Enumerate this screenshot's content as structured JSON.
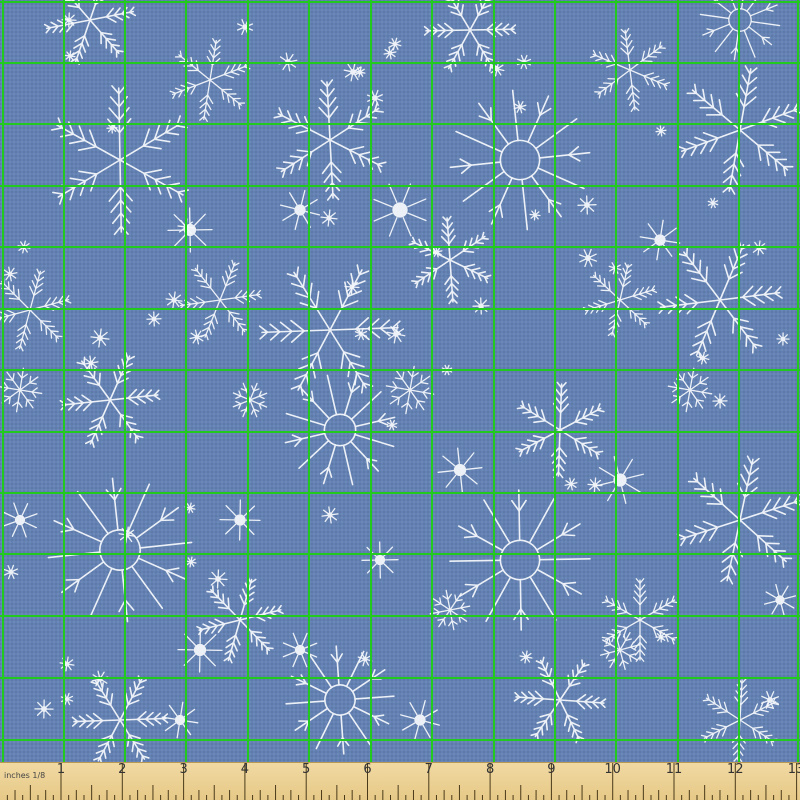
{
  "fabric": {
    "background_color": "#6381b3",
    "pattern_color": "#f4f7fb",
    "grid_color": "#22c91e",
    "pattern": "white line-art snowflakes on blue woven fabric"
  },
  "ruler": {
    "units_label": "inches 1/8",
    "numbers": [
      "1",
      "2",
      "3",
      "4",
      "5",
      "6",
      "7",
      "8",
      "9",
      "10",
      "11",
      "12",
      "13"
    ]
  }
}
